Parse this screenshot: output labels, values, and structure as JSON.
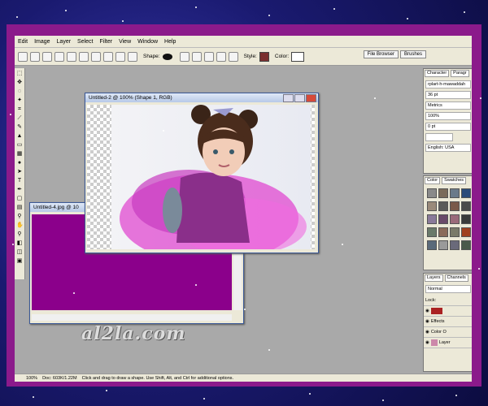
{
  "menubar": {
    "items": [
      "Edit",
      "Image",
      "Layer",
      "Select",
      "Filter",
      "View",
      "Window",
      "Help"
    ]
  },
  "optionsbar": {
    "shape_label": "Shape:",
    "style_label": "Style:",
    "color_label": "Color:",
    "style_color": "#7a2f2f"
  },
  "palette_tabs": [
    "File Browser",
    "Brushes"
  ],
  "window_main": {
    "title": "Untitled-2 @ 100% (Shape 1, RGB)"
  },
  "window_second": {
    "title": "Untitled-4.jpg @ 10",
    "canvas_color": "#8b008b"
  },
  "character_panel": {
    "tabs": [
      "Character",
      "Paragr"
    ],
    "font": "rplart-h-mawaddah",
    "size": "36 pt",
    "kerning": "Metrics",
    "scale": "100%",
    "baseline": "0 pt",
    "language": "English: USA"
  },
  "swatches_panel": {
    "tabs": [
      "Color",
      "Swatches"
    ],
    "colors": [
      "#8a8a8a",
      "#7a6a5a",
      "#6a7a8a",
      "#2a4a7a",
      "#9a8a7a",
      "#5a5a5a",
      "#7a5a4a",
      "#4a4a4a",
      "#8a7a9a",
      "#6a4a6a",
      "#9a6a7a",
      "#3a3a3a",
      "#6a7a6a",
      "#8a6a5a",
      "#7a7a6a",
      "#a04020",
      "#5a6a7a",
      "#9a9a9a",
      "#6a6a7a",
      "#4a5a4a"
    ]
  },
  "layers_panel": {
    "tabs": [
      "Layers",
      "Channels"
    ],
    "blend": "Normal",
    "lock_label": "Lock:",
    "rows": [
      "Effects",
      "Color O",
      "Layer"
    ]
  },
  "statusbar": {
    "zoom": "100%",
    "doc": "Doc: 603K/1.22M",
    "hint": "Click and drag to draw a shape. Use Shift, Alt, and Ctrl for additional options."
  },
  "watermark": "al2la.com"
}
